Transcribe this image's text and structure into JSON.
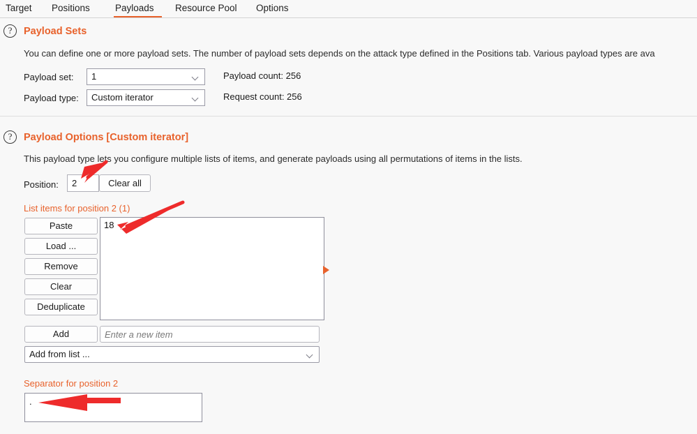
{
  "tabs": [
    {
      "label": "Target",
      "active": false
    },
    {
      "label": "Positions",
      "active": false
    },
    {
      "label": "Payloads",
      "active": true
    },
    {
      "label": "Resource Pool",
      "active": false
    },
    {
      "label": "Options",
      "active": false
    }
  ],
  "payload_sets": {
    "help_icon": "question-circle-icon",
    "title": "Payload Sets",
    "description": "You can define one or more payload sets. The number of payload sets depends on the attack type defined in the Positions tab. Various payload types are ava",
    "payload_set_label": "Payload set:",
    "payload_set_value": "1",
    "payload_type_label": "Payload type:",
    "payload_type_value": "Custom iterator",
    "payload_count": "Payload count: 256",
    "request_count": "Request count: 256"
  },
  "payload_options": {
    "help_icon": "question-circle-icon",
    "title": "Payload Options [Custom iterator]",
    "description": "This payload type lets you configure multiple lists of items, and generate payloads using all permutations of items in the lists.",
    "position_label": "Position:",
    "position_value": "2",
    "clear_all_label": "Clear all",
    "list_items_heading": "List items for position 2 (1)",
    "list_buttons": [
      "Paste",
      "Load ...",
      "Remove",
      "Clear",
      "Deduplicate"
    ],
    "list_items": [
      "18"
    ],
    "add_button_label": "Add",
    "add_input_placeholder": "Enter a new item",
    "add_input_value": "",
    "add_from_list_label": "Add from list ...",
    "separator_heading": "Separator for position 2",
    "separator_value": "."
  },
  "colors": {
    "accent": "#e8622c",
    "annotation": "#ee2b2b",
    "background": "#f8f8f8",
    "text": "#1a1a1a"
  }
}
